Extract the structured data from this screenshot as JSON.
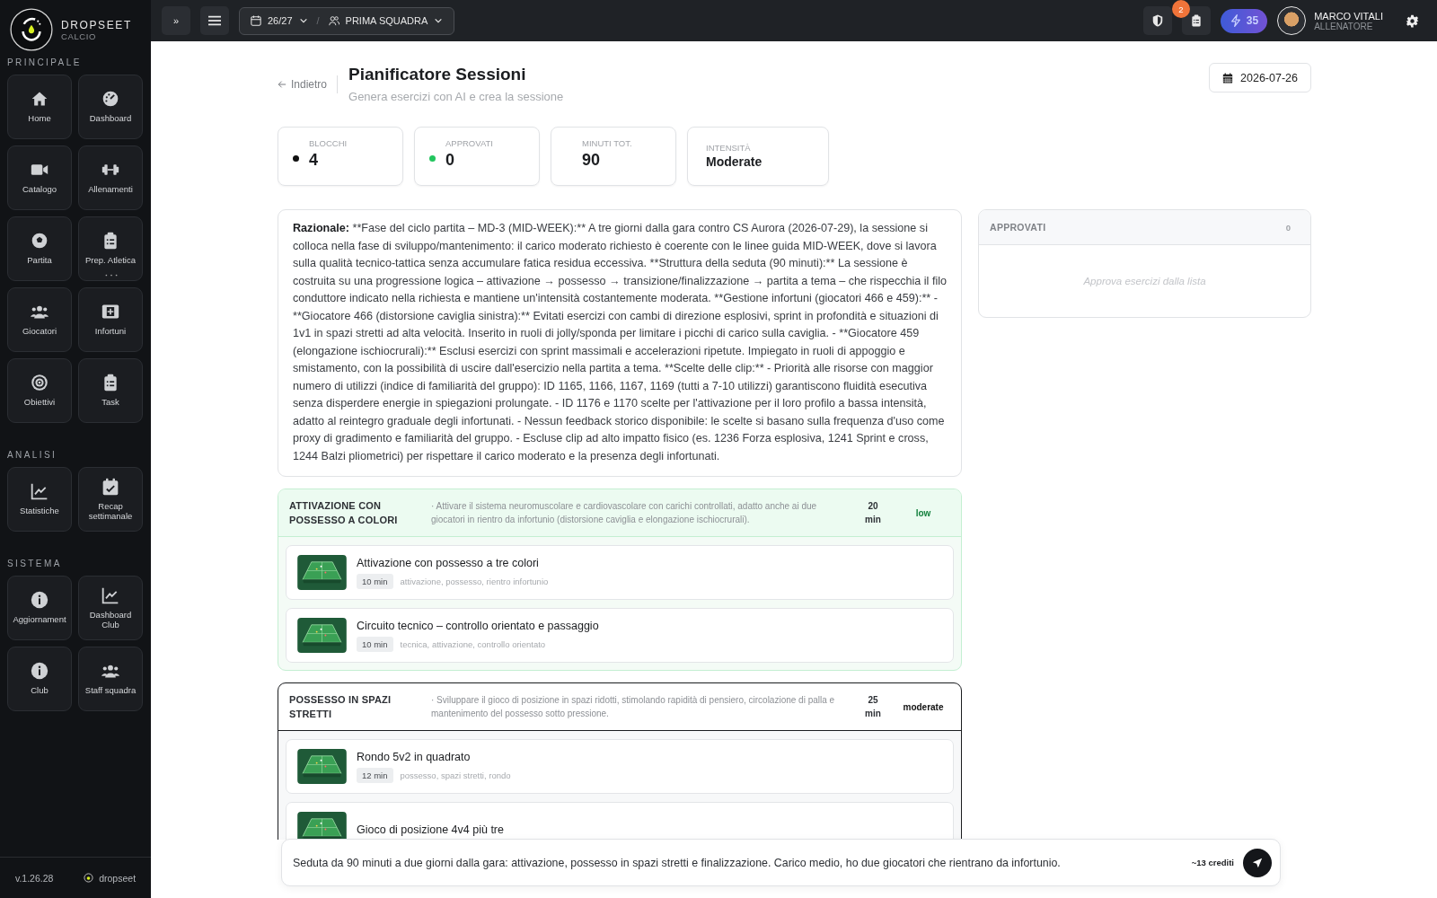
{
  "brand": {
    "name": "DROPSEET",
    "sub": "CALCIO"
  },
  "sidebar": {
    "sections": [
      {
        "title": "PRINCIPALE",
        "items": [
          {
            "label": "Home"
          },
          {
            "label": "Dashboard"
          },
          {
            "label": "Catalogo"
          },
          {
            "label": "Allenamenti"
          },
          {
            "label": "Partita"
          },
          {
            "label": "Prep. Atletica",
            "more": true
          },
          {
            "label": "Giocatori"
          },
          {
            "label": "Infortuni"
          },
          {
            "label": "Obiettivi"
          },
          {
            "label": "Task"
          }
        ]
      },
      {
        "title": "ANALISI",
        "items": [
          {
            "label": "Statistiche"
          },
          {
            "label": "Recap settimanale"
          }
        ]
      },
      {
        "title": "SISTEMA",
        "items": [
          {
            "label": "Aggiornament"
          },
          {
            "label": "Dashboard Club"
          },
          {
            "label": "Club"
          },
          {
            "label": "Staff squadra"
          }
        ]
      }
    ],
    "version": "v.1.26.28",
    "footer_brand": "dropseet"
  },
  "topbar": {
    "expand_glyph": "»",
    "season": "26/27",
    "separator": "/",
    "team": "PRIMA SQUADRA",
    "notifications": "2",
    "credits": "35",
    "user": {
      "name": "MARCO VITALI",
      "role": "ALLENATORE"
    }
  },
  "header": {
    "back": "Indietro",
    "title": "Pianificatore Sessioni",
    "subtitle": "Genera esercizi con AI e crea la sessione",
    "date": "2026-07-26"
  },
  "stats": [
    {
      "kind": "number",
      "label": "BLOCCHI",
      "value": "4",
      "color": "#111111"
    },
    {
      "kind": "number",
      "label": "APPROVATI",
      "value": "0",
      "color": "#22c55e"
    },
    {
      "kind": "number",
      "label": "MINUTI TOT.",
      "value": "90"
    },
    {
      "kind": "text",
      "label": "INTENSITÀ",
      "value": "Moderate"
    }
  ],
  "rationale": {
    "label": "Razionale:",
    "text": "**Fase del ciclo partita – MD-3 (MID-WEEK):** A tre giorni dalla gara contro CS Aurora (2026-07-29), la sessione si colloca nella fase di sviluppo/mantenimento: il carico moderato richiesto è coerente con le linee guida MID-WEEK, dove si lavora sulla qualità tecnico-tattica senza accumulare fatica residua eccessiva. **Struttura della seduta (90 minuti):** La sessione è costruita su una progressione logica – attivazione → possesso → transizione/finalizzazione → partita a tema – che rispecchia il filo conduttore indicato nella richiesta e mantiene un'intensità costantemente moderata. **Gestione infortuni (giocatori 466 e 459):** - **Giocatore 466 (distorsione caviglia sinistra):** Evitati esercizi con cambi di direzione esplosivi, sprint in profondità e situazioni di 1v1 in spazi stretti ad alta velocità. Inserito in ruoli di jolly/sponda per limitare i picchi di carico sulla caviglia. - **Giocatore 459 (elongazione ischiocrurali):** Esclusi esercizi con sprint massimali e accelerazioni ripetute. Impiegato in ruoli di appoggio e smistamento, con la possibilità di uscire dall'esercizio nella partita a tema. **Scelte delle clip:** - Priorità alle risorse con maggior numero di utilizzi (indice di familiarità del gruppo): ID 1165, 1166, 1167, 1169 (tutti a 7-10 utilizzi) garantiscono fluidità esecutiva senza disperdere energie in spiegazioni prolungate. - ID 1176 e 1170 scelte per l'attivazione per il loro profilo a bassa intensità, adatto al reintegro graduale degli infortunati. - Nessun feedback storico disponibile: le scelte si basano sulla frequenza d'uso come proxy di gradimento e familiarità del gruppo. - Escluse clip ad alto impatto fisico (es. 1236 Forza esplosiva, 1241 Sprint e cross, 1244 Balzi pliometrici) per rispettare il carico moderato e la presenza degli infortunati."
  },
  "blocks": [
    {
      "kind": "highlight",
      "title": "ATTIVAZIONE CON POSSESSO A COLORI",
      "description": "· Attivare il sistema neuromuscolare e cardiovascolare con carichi controllati, adatto anche ai due giocatori in rientro da infortunio (distorsione caviglia e elongazione ischiocrurali).",
      "minutes": "20",
      "min_unit": "min",
      "intensity": "low",
      "exercises": [
        {
          "title": "Attivazione con possesso a tre colori",
          "duration": "10 min",
          "tags": "attivazione, possesso, rientro infortunio"
        },
        {
          "title": "Circuito tecnico – controllo orientato e passaggio",
          "duration": "10 min",
          "tags": "tecnica, attivazione, controllo orientato"
        }
      ]
    },
    {
      "kind": "plain",
      "title": "POSSESSO IN SPAZI STRETTI",
      "description": "· Sviluppare il gioco di posizione in spazi ridotti, stimolando rapidità di pensiero, circolazione di palla e mantenimento del possesso sotto pressione.",
      "minutes": "25",
      "min_unit": "min",
      "intensity": "moderate",
      "exercises": [
        {
          "title": "Rondo 5v2 in quadrato",
          "duration": "12 min",
          "tags": "possesso, spazi stretti, rondo"
        },
        {
          "title": "Gioco di posizione 4v4 più tre"
        }
      ]
    }
  ],
  "approved_panel": {
    "title": "APPROVATI",
    "count": "0",
    "empty": "Approva esercizi dalla lista"
  },
  "composer": {
    "value": "Seduta da 90 minuti a due giorni dalla gara: attivazione, possesso in spazi stretti e finalizzazione. Carico medio, ho due giocatori che rientrano da infortunio.",
    "cost": "~13 crediti"
  }
}
